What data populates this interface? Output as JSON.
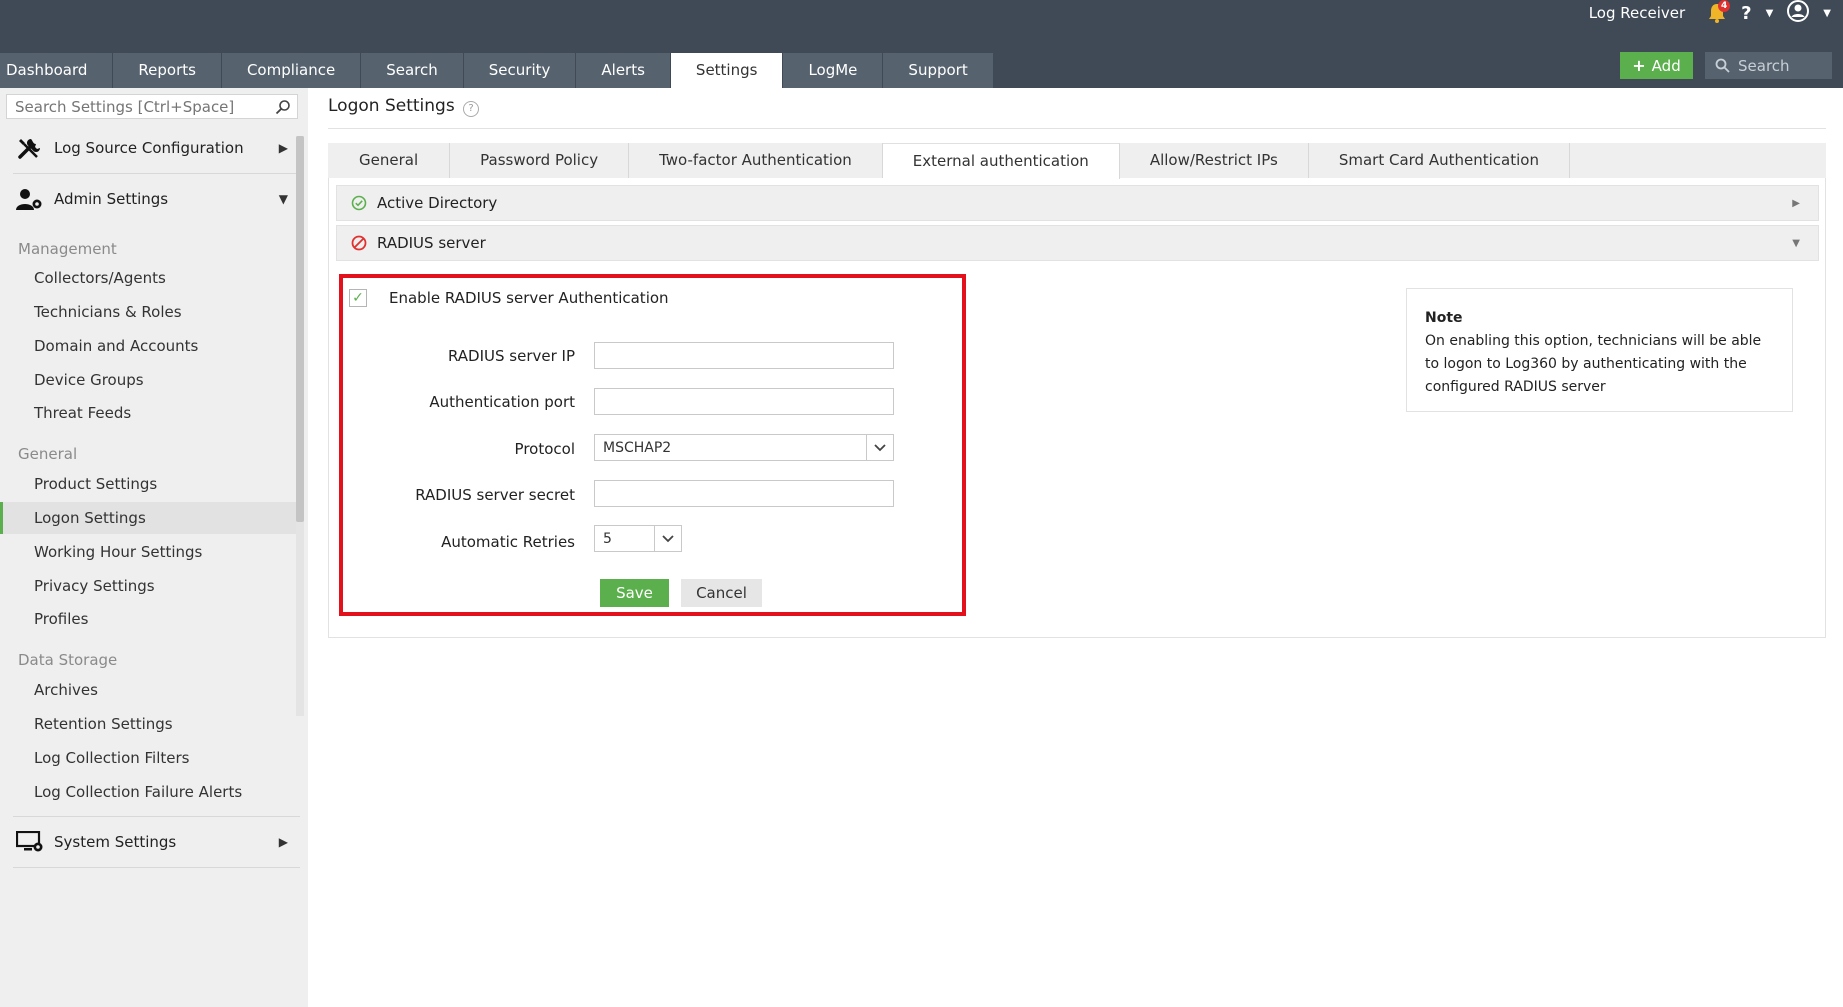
{
  "header": {
    "app_name": "Log Receiver",
    "notification_count": "4",
    "help_label": "?"
  },
  "nav": {
    "tabs": [
      {
        "label": "Dashboard"
      },
      {
        "label": "Reports"
      },
      {
        "label": "Compliance"
      },
      {
        "label": "Search"
      },
      {
        "label": "Security"
      },
      {
        "label": "Alerts"
      },
      {
        "label": "Settings"
      },
      {
        "label": "LogMe"
      },
      {
        "label": "Support"
      }
    ],
    "add_label": "Add",
    "search_placeholder": "Search"
  },
  "sidebar": {
    "search_placeholder": "Search Settings [Ctrl+Space]",
    "log_source": "Log Source Configuration",
    "admin_settings": "Admin Settings",
    "groups": {
      "management": "Management",
      "general": "General",
      "data_storage": "Data Storage"
    },
    "management_items": [
      "Collectors/Agents",
      "Technicians & Roles",
      "Domain and Accounts",
      "Device Groups",
      "Threat Feeds"
    ],
    "general_items": [
      "Product Settings",
      "Logon Settings",
      "Working Hour Settings",
      "Privacy Settings",
      "Profiles"
    ],
    "storage_items": [
      "Archives",
      "Retention Settings",
      "Log Collection Filters",
      "Log Collection Failure Alerts"
    ],
    "system_settings": "System Settings"
  },
  "page": {
    "title": "Logon Settings",
    "subtabs": [
      "General",
      "Password Policy",
      "Two-factor Authentication",
      "External authentication",
      "Allow/Restrict IPs",
      "Smart Card Authentication"
    ]
  },
  "accordion": {
    "active_directory": "Active Directory",
    "radius_server": "RADIUS server"
  },
  "form": {
    "enable_label": "Enable RADIUS server Authentication",
    "ip_label": "RADIUS server IP",
    "ip_value": "",
    "port_label": "Authentication port",
    "port_value": "",
    "protocol_label": "Protocol",
    "protocol_value": "MSCHAP2",
    "secret_label": "RADIUS server secret",
    "secret_value": "",
    "retries_label": "Automatic Retries",
    "retries_value": "5",
    "save_label": "Save",
    "cancel_label": "Cancel"
  },
  "note": {
    "title": "Note",
    "text": "On enabling this option, technicians will be able to logon to Log360 by authenticating with the configured RADIUS server"
  },
  "colors": {
    "header_bg": "#3f4a56",
    "tab_bg": "#56636f",
    "accent_green": "#5bb04d",
    "highlight_red": "#e3111b",
    "alert_red": "#e0312f"
  }
}
